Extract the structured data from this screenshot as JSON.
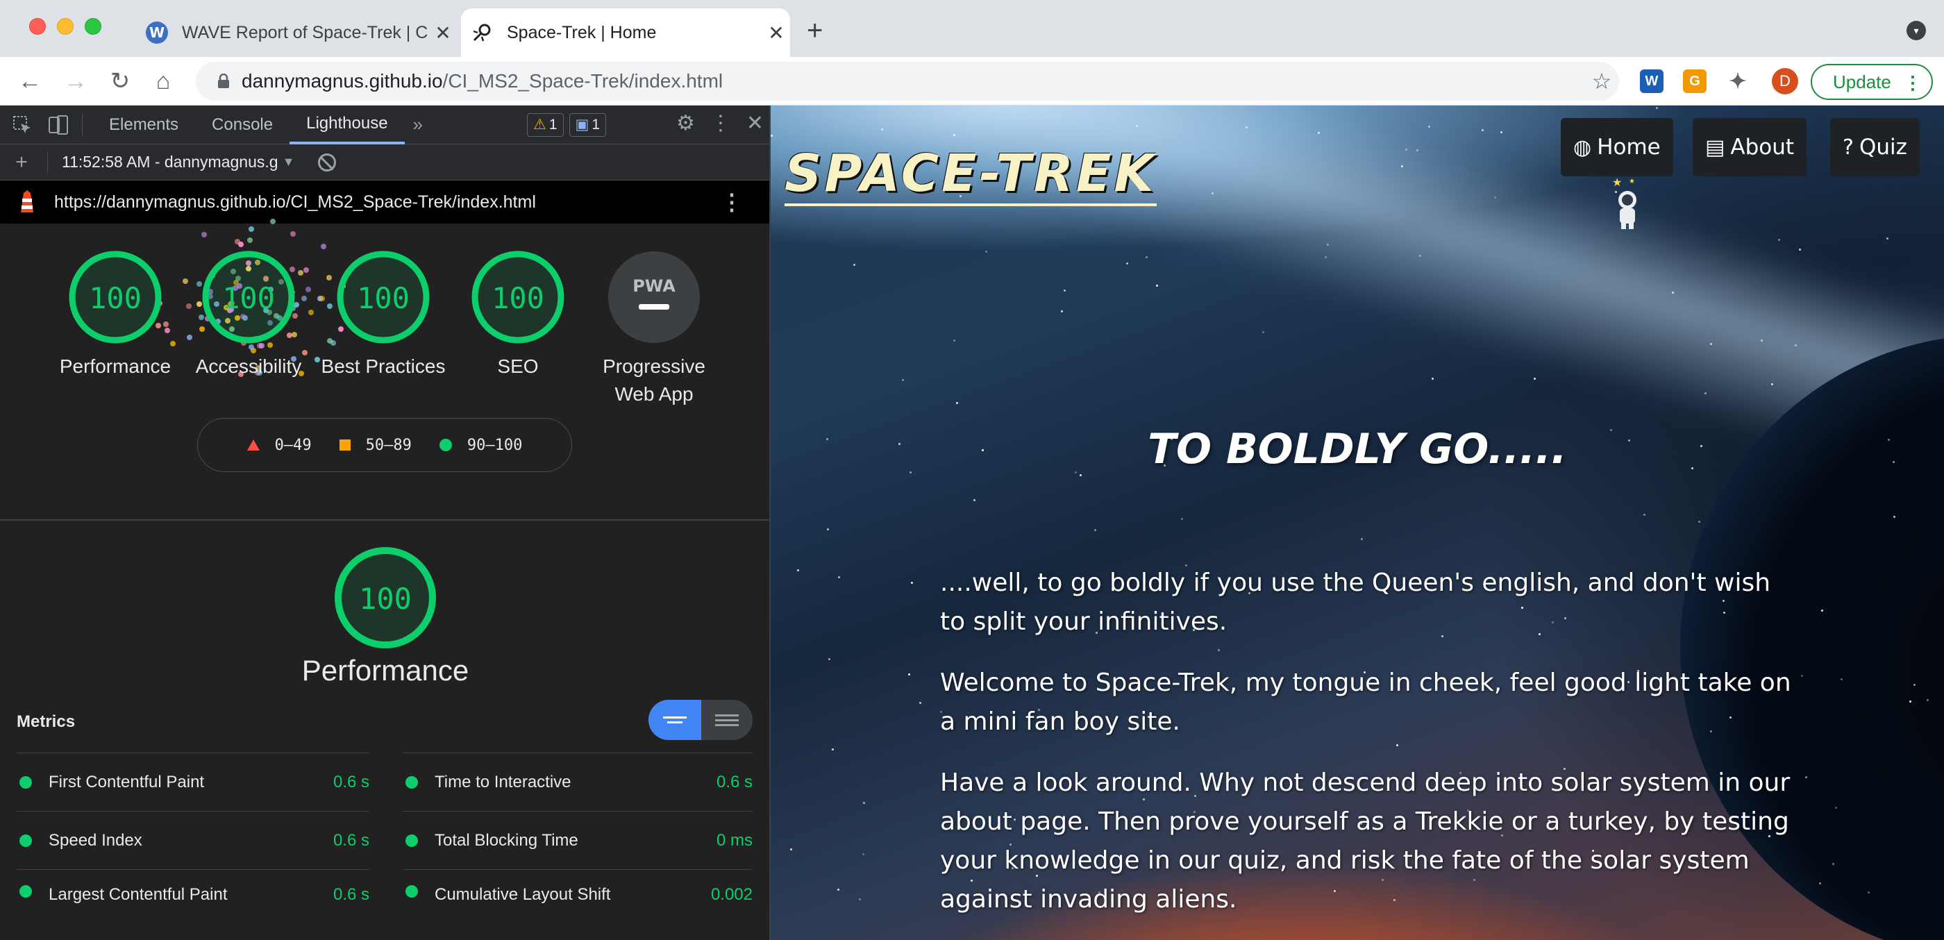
{
  "browser": {
    "tabs": [
      {
        "title": "WAVE Report of Space-Trek | C",
        "icon": "wave-icon"
      },
      {
        "title": "Space-Trek | Home",
        "icon": "rocket-icon"
      }
    ],
    "address": {
      "domain": "dannymagnus.github.io",
      "path": "/CI_MS2_Space-Trek/index.html"
    },
    "profile_initial": "D",
    "update_label": "Update"
  },
  "devtools": {
    "tabs": [
      "Elements",
      "Console",
      "Lighthouse"
    ],
    "active_tab": "Lighthouse",
    "warnings": "1",
    "messages": "1",
    "report_selector": "11:52:58 AM - dannymagnus.g",
    "report_url": "https://dannymagnus.github.io/CI_MS2_Space-Trek/index.html"
  },
  "lighthouse": {
    "gauges": [
      {
        "score": "100",
        "label": "Performance"
      },
      {
        "score": "100",
        "label": "Accessibility"
      },
      {
        "score": "100",
        "label": "Best Practices"
      },
      {
        "score": "100",
        "label": "SEO"
      },
      {
        "score": "PWA",
        "label": "Progressive Web App"
      }
    ],
    "legend": [
      "0–49",
      "50–89",
      "90–100"
    ],
    "performance_score": "100",
    "performance_title": "Performance",
    "metrics_title": "Metrics",
    "metrics": [
      {
        "name": "First Contentful Paint",
        "value": "0.6 s"
      },
      {
        "name": "Time to Interactive",
        "value": "0.6 s"
      },
      {
        "name": "Speed Index",
        "value": "0.6 s"
      },
      {
        "name": "Total Blocking Time",
        "value": "0 ms"
      },
      {
        "name": "Largest Contentful Paint",
        "value": "0.6 s"
      },
      {
        "name": "Cumulative Layout Shift",
        "value": "0.002"
      }
    ],
    "colors": {
      "pass": "#0cce6b",
      "average": "#ffa400",
      "fail": "#ff4e42"
    }
  },
  "site": {
    "logo": "SPACE-TREK",
    "nav": [
      {
        "label": "Home",
        "icon": "globe-icon"
      },
      {
        "label": "About",
        "icon": "id-card-icon"
      },
      {
        "label": "Quiz",
        "icon": "question-icon"
      }
    ],
    "heading": "TO BOLDLY GO.....",
    "paragraphs": [
      "....well, to go boldly if you use the Queen's english, and don't wish to split your infinitives.",
      "Welcome to Space-Trek, my tongue in cheek, feel good light take on a mini fan boy site.",
      "Have a look around. Why not descend deep into solar system in our about page. Then prove yourself as a Trekkie or a turkey, by testing your knowledge in our quiz, and risk the fate of the solar system against invading aliens."
    ]
  }
}
